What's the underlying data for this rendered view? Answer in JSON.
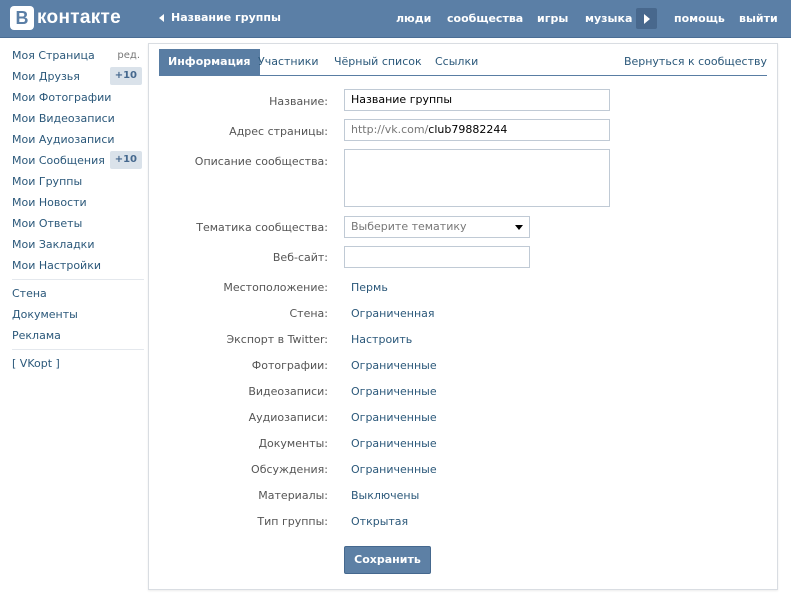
{
  "header": {
    "logo_letter": "B",
    "logo_text": "контакте",
    "back_label": "Название группы",
    "nav": [
      "люди",
      "сообщества",
      "игры",
      "музыка",
      "помощь",
      "выйти"
    ]
  },
  "sidebar": {
    "items": [
      {
        "label": "Моя Страница",
        "extra": "ред."
      },
      {
        "label": "Мои Друзья",
        "badge": "+10"
      },
      {
        "label": "Мои Фотографии"
      },
      {
        "label": "Мои Видеозаписи"
      },
      {
        "label": "Мои Аудиозаписи"
      },
      {
        "label": "Мои Сообщения",
        "badge": "+10"
      },
      {
        "label": "Мои Группы"
      },
      {
        "label": "Мои Новости"
      },
      {
        "label": "Мои Ответы"
      },
      {
        "label": "Мои Закладки"
      },
      {
        "label": "Мои Настройки"
      }
    ],
    "secondary": [
      "Стена",
      "Документы",
      "Реклама"
    ],
    "vkopt": "[ VKopt ]"
  },
  "tabs": {
    "items": [
      "Информация",
      "Участники",
      "Чёрный список",
      "Ссылки"
    ],
    "active": "Информация",
    "return_label": "Вернуться к сообществу"
  },
  "form": {
    "name": {
      "label": "Название:",
      "value": "Название группы"
    },
    "address": {
      "label": "Адрес страницы:",
      "prefix": "http://vk.com/",
      "value": "club79882244"
    },
    "description": {
      "label": "Описание сообщества:",
      "value": ""
    },
    "topic": {
      "label": "Тематика сообщества:",
      "placeholder": "Выберите тематику"
    },
    "website": {
      "label": "Веб-сайт:",
      "value": ""
    },
    "settings": [
      {
        "label": "Местоположение:",
        "value": "Пермь"
      },
      {
        "label": "Стена:",
        "value": "Ограниченная"
      },
      {
        "label": "Экспорт в Twitter:",
        "value": "Настроить"
      },
      {
        "label": "Фотографии:",
        "value": "Ограниченные"
      },
      {
        "label": "Видеозаписи:",
        "value": "Ограниченные"
      },
      {
        "label": "Аудиозаписи:",
        "value": "Ограниченные"
      },
      {
        "label": "Документы:",
        "value": "Ограниченные"
      },
      {
        "label": "Обсуждения:",
        "value": "Ограниченные"
      },
      {
        "label": "Материалы:",
        "value": "Выключены"
      },
      {
        "label": "Тип группы:",
        "value": "Открытая"
      }
    ],
    "save_label": "Сохранить"
  },
  "colors": {
    "header_bg": "#5b7fa6",
    "link": "#2b587a",
    "active_tab": "#597da3",
    "button": "#5d80a5"
  },
  "icons": [
    "back-arrow-icon",
    "play-icon",
    "dropdown-arrow-icon"
  ]
}
